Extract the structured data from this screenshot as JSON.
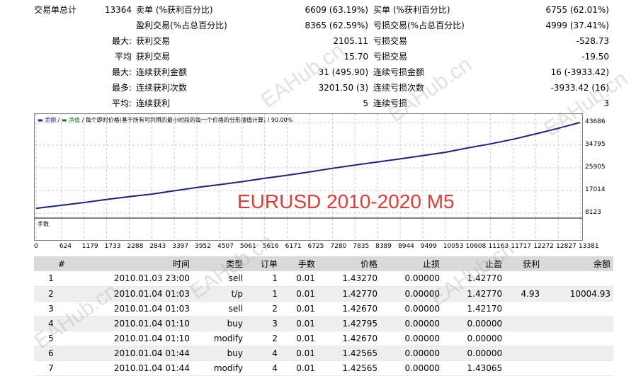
{
  "stats": {
    "row1": {
      "label": "交易单总计",
      "value": "13364",
      "l_label": "卖单 (%获利百分比)",
      "l_value": "6609 (63.19%)",
      "r_label": "买单 (%获利百分比)",
      "r_value": "6755 (62.01%)"
    },
    "row2": {
      "l_label": "盈利交易(%占总百分比)",
      "l_value": "8365 (62.59%)",
      "r_label": "亏损交易(%占总百分比)",
      "r_value": "4999 (37.41%)"
    },
    "row3": {
      "prefix": "最大:",
      "l_label": "获利交易",
      "l_value": "2105.11",
      "r_label": "亏损交易",
      "r_value": "-528.73"
    },
    "row4": {
      "prefix": "平均",
      "l_label": "获利交易",
      "l_value": "15.70",
      "r_label": "亏损交易",
      "r_value": "-19.50"
    },
    "row5": {
      "prefix": "最大:",
      "l_label": "连续获利金额",
      "l_value": "31 (495.90)",
      "r_label": "连续亏损金额",
      "r_value": "16 (-3933.42)"
    },
    "row6": {
      "prefix": "最多:",
      "l_label": "连续获利次数",
      "l_value": "3201.50 (3)",
      "r_label": "连续亏损次数",
      "r_value": "-3933.42 (16)"
    },
    "row7": {
      "prefix": "平均:",
      "l_label": "连续获利",
      "l_value": "5",
      "r_label": "连续亏损",
      "r_value": "3"
    }
  },
  "chart_legend": {
    "balance": "余额",
    "equity": "净值",
    "model": "每个即时价格(基于所有可利用的最小时段的每一个价格的分形插值计算)",
    "quality": "90.00%"
  },
  "overlay_title": "EURUSD 2010-2020 M5",
  "volume_label": "手数",
  "chart_data": {
    "type": "line",
    "series": [
      {
        "name": "余额",
        "color": "#1a237e"
      }
    ],
    "x_ticks": [
      "0",
      "624",
      "1179",
      "1733",
      "2288",
      "2843",
      "3397",
      "3952",
      "4507",
      "5061",
      "5616",
      "6171",
      "6725",
      "7280",
      "7835",
      "8389",
      "8944",
      "9499",
      "10053",
      "10608",
      "11163",
      "11717",
      "12272",
      "12827",
      "13381"
    ],
    "y_ticks": [
      "43686",
      "34795",
      "25905",
      "17014",
      "8123"
    ],
    "x": [
      0,
      624,
      1179,
      1733,
      2288,
      2843,
      3397,
      3952,
      4507,
      5061,
      5616,
      6171,
      6725,
      7280,
      7835,
      8389,
      8944,
      9499,
      10053,
      10608,
      11163,
      11717,
      12272,
      12827,
      13364
    ],
    "y": [
      10004,
      11200,
      12300,
      13500,
      14600,
      15600,
      16900,
      18200,
      19300,
      20500,
      21800,
      23000,
      24300,
      25700,
      27000,
      28200,
      29400,
      30700,
      32000,
      33700,
      35300,
      37100,
      39200,
      41400,
      43686
    ],
    "ylim": [
      8123,
      43686
    ],
    "xlim": [
      0,
      13381
    ],
    "grid": true
  },
  "table": {
    "headers": [
      "#",
      "时间",
      "类型",
      "订单",
      "手数",
      "价格",
      "止损",
      "止盈",
      "获利",
      "余额"
    ],
    "rows": [
      [
        "1",
        "2010.01.03 23:00",
        "sell",
        "1",
        "0.01",
        "1.43270",
        "0.00000",
        "1.42770",
        "",
        ""
      ],
      [
        "2",
        "2010.01.04 01:03",
        "t/p",
        "1",
        "0.01",
        "1.42770",
        "0.00000",
        "1.42770",
        "4.93",
        "10004.93"
      ],
      [
        "3",
        "2010.01.04 01:03",
        "sell",
        "2",
        "0.01",
        "1.42670",
        "0.00000",
        "1.42170",
        "",
        ""
      ],
      [
        "4",
        "2010.01.04 01:10",
        "buy",
        "3",
        "0.01",
        "1.42795",
        "0.00000",
        "0.00000",
        "",
        ""
      ],
      [
        "5",
        "2010.01.04 01:10",
        "modify",
        "2",
        "0.01",
        "1.42670",
        "0.00000",
        "0.00000",
        "",
        ""
      ],
      [
        "6",
        "2010.01.04 01:44",
        "buy",
        "4",
        "0.01",
        "1.42565",
        "0.00000",
        "0.00000",
        "",
        ""
      ],
      [
        "7",
        "2010.01.04 01:44",
        "modify",
        "4",
        "0.01",
        "1.42565",
        "0.00000",
        "1.43065",
        "",
        ""
      ]
    ]
  },
  "watermark": "EAHub.cn"
}
